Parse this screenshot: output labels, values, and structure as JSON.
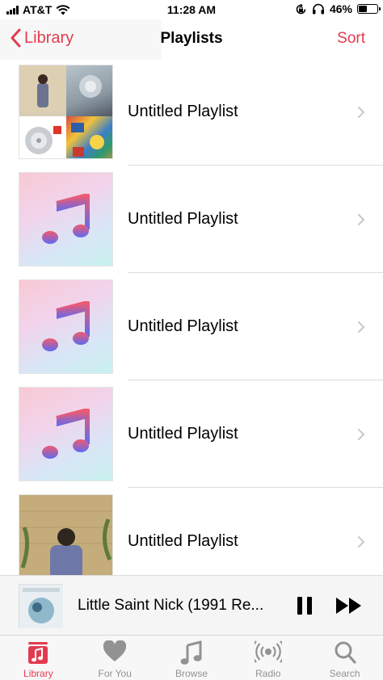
{
  "status_bar": {
    "carrier": "AT&T",
    "time": "11:28 AM",
    "battery_percent": "46%",
    "battery_level": 0.46,
    "icons": [
      "signal-icon",
      "wifi-icon",
      "orientation-lock-icon",
      "headphones-icon",
      "battery-icon"
    ]
  },
  "nav": {
    "back_label": "Library",
    "title": "Playlists",
    "sort_label": "Sort"
  },
  "playlists": [
    {
      "name": "Untitled Playlist",
      "artwork": "album-collage"
    },
    {
      "name": "Untitled Playlist",
      "artwork": "default-music-note"
    },
    {
      "name": "Untitled Playlist",
      "artwork": "default-music-note"
    },
    {
      "name": "Untitled Playlist",
      "artwork": "default-music-note"
    },
    {
      "name": "Untitled Playlist",
      "artwork": "album-photo"
    }
  ],
  "now_playing": {
    "title": "Little Saint Nick (1991 Re..."
  },
  "tabs": [
    {
      "label": "Library",
      "icon": "library-icon",
      "active": true
    },
    {
      "label": "For You",
      "icon": "heart-icon",
      "active": false
    },
    {
      "label": "Browse",
      "icon": "music-note-icon",
      "active": false
    },
    {
      "label": "Radio",
      "icon": "radio-icon",
      "active": false
    },
    {
      "label": "Search",
      "icon": "search-icon",
      "active": false
    }
  ],
  "colors": {
    "accent": "#e23b4f",
    "inactive_tab": "#929292",
    "separator": "#dcdcdc",
    "note_gradient_top": "#f25a6e",
    "note_gradient_bottom": "#5e6bf0"
  }
}
